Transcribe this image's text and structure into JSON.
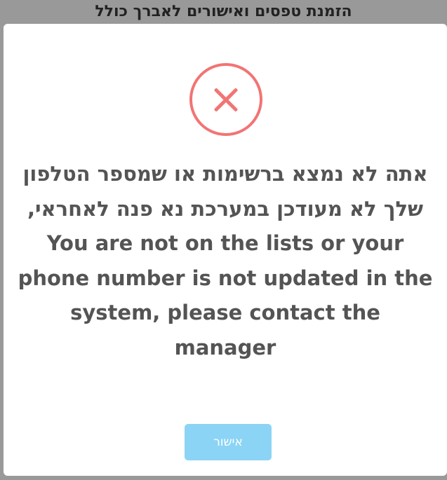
{
  "background_page": {
    "title": "הזמנת טפסים ואישורים לאברך כולל"
  },
  "dialog": {
    "icon": "error-x-icon",
    "icon_color": "#f27474",
    "message": "אתה לא נמצא ברשימות או שמספר הטלפון שלך לא מעודכן במערכת נא פנה לאחראי, You are not on the lists or your phone number is not updated in the system, please contact the manager",
    "confirm_label": "אישור",
    "confirm_color": "#8cd4f5"
  }
}
